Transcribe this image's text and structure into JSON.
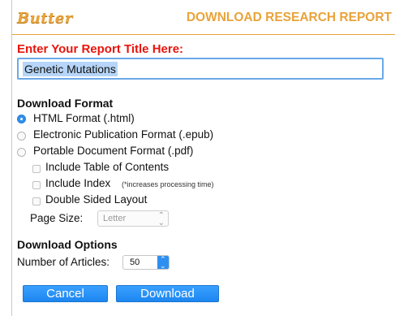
{
  "header": {
    "logo_text": "Butter",
    "title": "DOWNLOAD RESEARCH REPORT"
  },
  "report_title": {
    "label": "Enter Your Report Title Here:",
    "value": "Genetic Mutations"
  },
  "download_format": {
    "heading": "Download Format",
    "options": [
      {
        "label": "HTML Format (.html)",
        "selected": true
      },
      {
        "label": "Electronic Publication Format (.epub)",
        "selected": false
      },
      {
        "label": "Portable Document Format (.pdf)",
        "selected": false
      }
    ],
    "pdf_options": [
      {
        "label": "Include Table of Contents",
        "checked": false
      },
      {
        "label": "Include Index",
        "note": "(*increases processing time)",
        "checked": false
      },
      {
        "label": "Double Sided Layout",
        "checked": false
      }
    ],
    "page_size": {
      "label": "Page Size:",
      "value": "Letter"
    }
  },
  "download_options": {
    "heading": "Download Options",
    "articles_label": "Number of Articles:",
    "articles_value": "50"
  },
  "buttons": {
    "cancel": "Cancel",
    "download": "Download"
  },
  "colors": {
    "brand_orange": "#e9a33a",
    "label_red": "#e8140c",
    "accent_blue": "#2f8ff0"
  }
}
